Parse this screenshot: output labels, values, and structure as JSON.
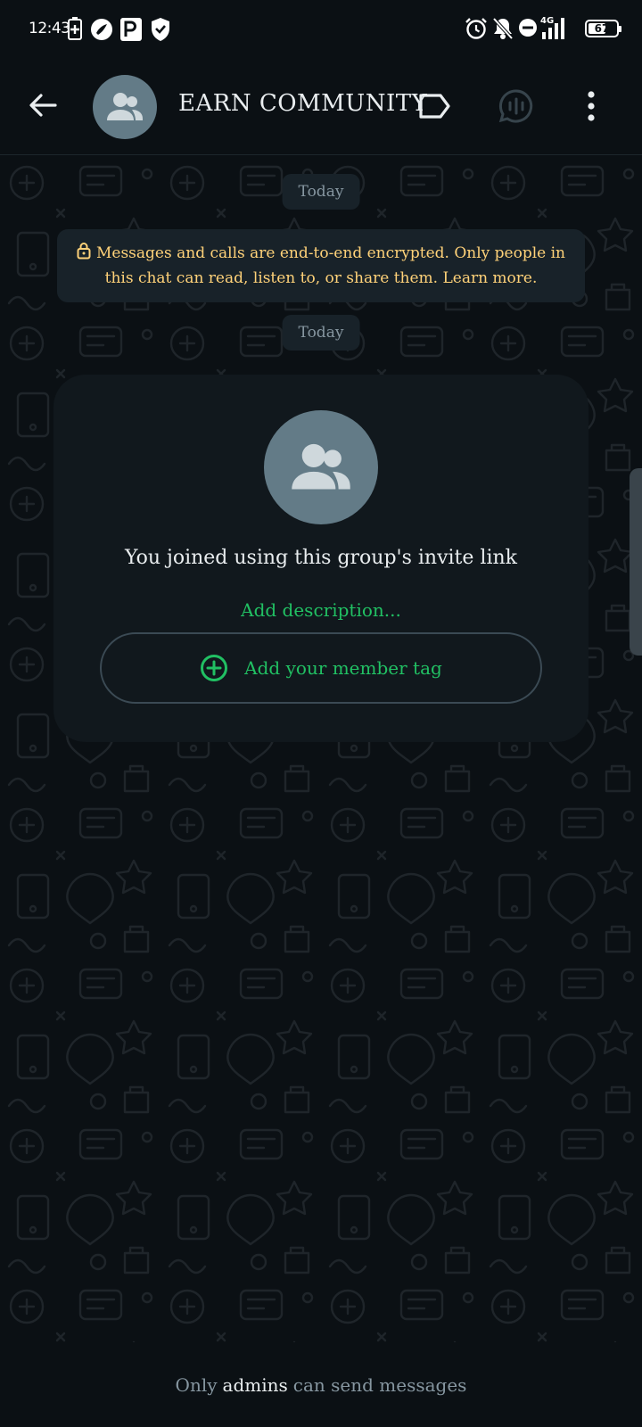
{
  "status_bar": {
    "time": "12:43",
    "network": "4G",
    "battery": "67",
    "battery_level": 0.67
  },
  "header": {
    "title": "EARN COMMUNITY",
    "icons": [
      "arrow-left-icon",
      "group-avatar-icon",
      "label-icon",
      "voice-chat-icon",
      "more-vertical-icon"
    ]
  },
  "chat": {
    "date_pill_1": "Today",
    "encryption_notice": "Messages and calls are end-to-end encrypted. Only people in this chat can read, listen to, or share them. Learn more.",
    "date_pill_2": "Today",
    "card": {
      "joined_text": "You joined using this group's invite link",
      "add_description": "Add description...",
      "member_tag_button": "Add your member tag"
    }
  },
  "footer": {
    "prefix": "Only",
    "highlight": "admins",
    "suffix": "can send messages"
  },
  "colors": {
    "background": "#0b1014",
    "accent_green": "#21c063",
    "notice_yellow": "#ffd279",
    "pill_bg": "#182229",
    "avatar_bg": "#637b87"
  }
}
